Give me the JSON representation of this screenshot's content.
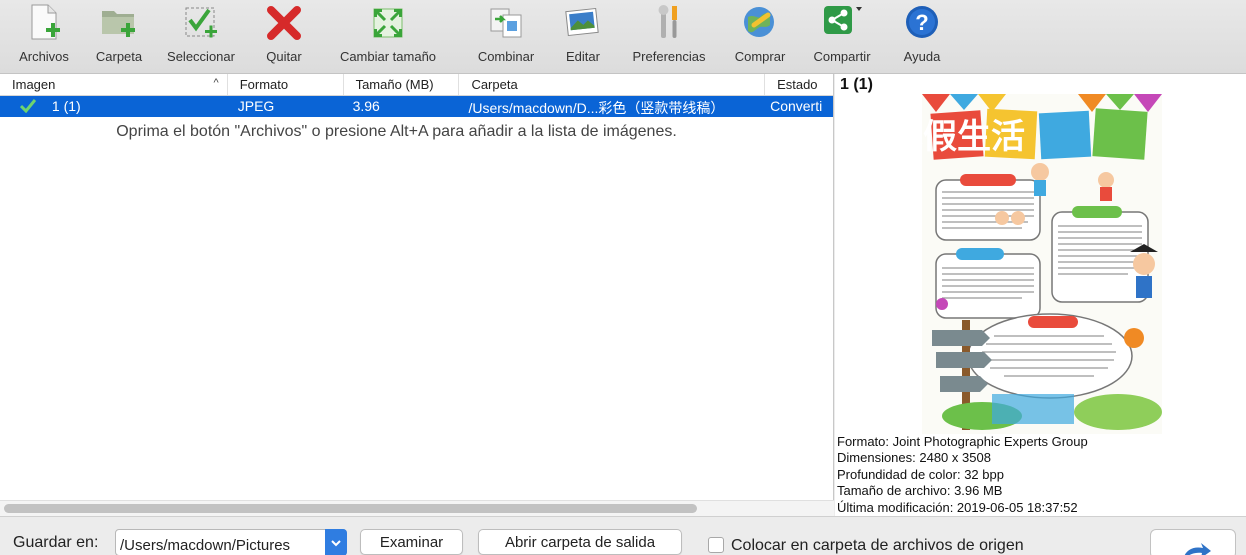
{
  "toolbar": {
    "items": [
      {
        "label": "Archivos",
        "icon": "add-file-icon"
      },
      {
        "label": "Carpeta",
        "icon": "add-folder-icon"
      },
      {
        "label": "Seleccionar",
        "icon": "select-icon"
      },
      {
        "label": "Quitar",
        "icon": "remove-icon"
      },
      {
        "label": "Cambiar tamaño",
        "icon": "resize-icon"
      },
      {
        "label": "Combinar",
        "icon": "combine-icon"
      },
      {
        "label": "Editar",
        "icon": "edit-icon"
      },
      {
        "label": "Preferencias",
        "icon": "preferences-icon"
      },
      {
        "label": "Comprar",
        "icon": "buy-icon"
      },
      {
        "label": "Compartir",
        "icon": "share-icon"
      },
      {
        "label": "Ayuda",
        "icon": "help-icon"
      }
    ]
  },
  "list": {
    "columns": [
      "Imagen",
      "Formato",
      "Tamaño (MB)",
      "Carpeta",
      "Estado"
    ],
    "sort_indicator": "^",
    "rows": [
      {
        "name": "1 (1)",
        "format": "JPEG",
        "size": "3.96",
        "folder": "/Users/macdown/D...彩色（竖款带线稿）",
        "status": "Converti"
      }
    ],
    "hint": "Oprima el botón \"Archivos\" o presione Alt+A para añadir a la lista de imágenes."
  },
  "preview": {
    "title": "1 (1)",
    "image_title_text": "寒假生活",
    "info": [
      "Formato: Joint Photographic Experts Group",
      "Dimensiones: 2480 x 3508",
      "Profundidad de color: 32 bpp",
      "Tamaño de archivo: 3.96 MB",
      "Última modificación: 2019-06-05 18:37:52"
    ]
  },
  "bottom": {
    "save_label": "Guardar en:",
    "save_path": "/Users/macdown/Pictures",
    "browse_label": "Examinar",
    "open_output_label": "Abrir carpeta de salida",
    "source_folder_label": "Colocar en carpeta de archivos de origen"
  },
  "colors": {
    "selection": "#0a64d6",
    "accent": "#2f7de1"
  }
}
